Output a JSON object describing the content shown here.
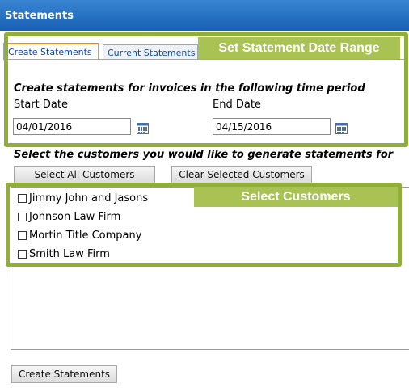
{
  "window": {
    "title": "Statements"
  },
  "tabs": [
    {
      "label": "Create Statements"
    },
    {
      "label": "Current Statements"
    }
  ],
  "callouts": {
    "date_range": "Set Statement Date Range",
    "customers": "Select Customers"
  },
  "date_section": {
    "heading": "Create statements for invoices in the following time period",
    "start_label": "Start Date",
    "start_value": "04/01/2016",
    "end_label": "End Date",
    "end_value": "04/15/2016"
  },
  "customers_section": {
    "heading": "Select the customers you would like to generate statements for",
    "select_all_label": "Select All Customers",
    "clear_label": "Clear Selected Customers",
    "items": [
      {
        "name": "Jimmy John and Jasons",
        "checked": false
      },
      {
        "name": "Johnson Law Firm",
        "checked": false
      },
      {
        "name": "Mortin Title Company",
        "checked": false
      },
      {
        "name": "Smith Law Firm",
        "checked": false
      }
    ]
  },
  "footer": {
    "create_label": "Create Statements"
  },
  "colors": {
    "titlebar": "#1f6fc4",
    "callout": "#8fae3a",
    "tab_accent": "#e68b17"
  },
  "icons": {
    "calendar": "calendar-icon"
  }
}
